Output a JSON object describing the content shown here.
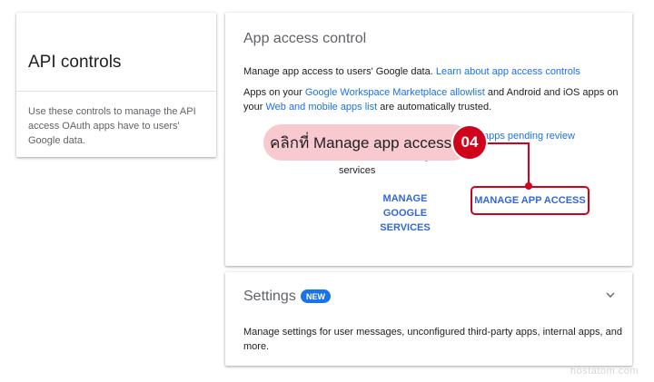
{
  "api_card": {
    "title": "API controls",
    "description": "Use these controls to manage the API access OAuth apps have to users' Google data."
  },
  "access_card": {
    "title": "App access control",
    "p1_text": "Manage app access to users' Google data. ",
    "p1_link": "Learn about app access controls",
    "p2_text1": "Apps on your ",
    "p2_link1": "Google Workspace Marketplace allowlist",
    "p2_text2": " and Android and iOS apps on your ",
    "p2_link2": "Web and mobile apps list",
    "p2_text3": " are automatically trusted.",
    "obscured_text": "to unrestricted Google services",
    "pending_link": "apps pending review",
    "manage_google_services": "MANAGE GOOGLE SERVICES",
    "manage_app_access": "MANAGE APP ACCESS"
  },
  "callout": {
    "text": "คลิกที่ Manage app access",
    "step": "04",
    "color": "#d0021b",
    "pill_color": "#f8c9cf"
  },
  "settings_card": {
    "title": "Settings",
    "badge": "NEW",
    "description": "Manage settings for user messages, unconfigured third-party apps, internal apps, and more.",
    "chevron_icon": "chevron-down-icon"
  },
  "watermark": "hostatom.com",
  "colors": {
    "link": "#1a73e8",
    "button_text": "#3367d6",
    "badge_bg": "#1a73e8"
  }
}
